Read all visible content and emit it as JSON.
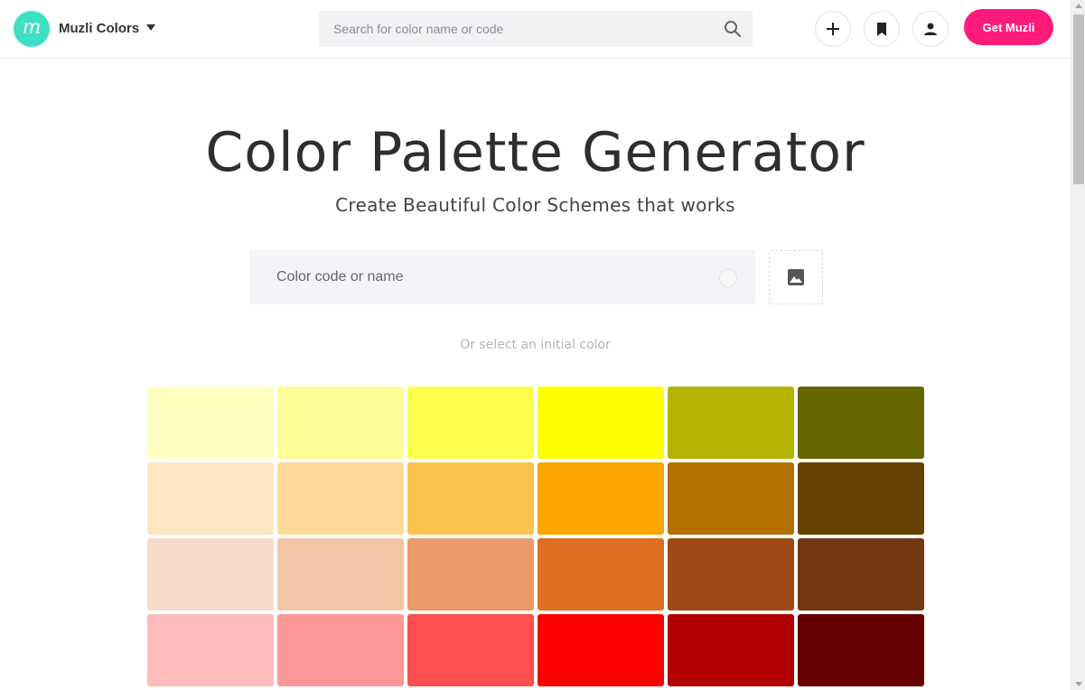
{
  "header": {
    "logo_letter": "m",
    "brand_name": "Muzli Colors",
    "search_placeholder": "Search for color name or code",
    "get_button_label": "Get Muzli",
    "accent_color": "#ff1b7a",
    "logo_color": "#3ee0c4"
  },
  "hero": {
    "title": "Color Palette Generator",
    "subtitle": "Create Beautiful Color Schemes that works",
    "input_placeholder": "Color code or name",
    "hint": "Or select an initial color"
  },
  "swatches": [
    [
      "#ffffc2",
      "#fdfd96",
      "#fdfd4b",
      "#ffff00",
      "#b3b300",
      "#666600"
    ],
    [
      "#fde6c2",
      "#fdd998",
      "#fdc14f",
      "#fca400",
      "#b37200",
      "#664200"
    ],
    [
      "#f5dbc9",
      "#f2c5a7",
      "#ea9a68",
      "#df6f21",
      "#9e4916",
      "#733711"
    ],
    [
      "#fdbbbb",
      "#fd9898",
      "#fd4f4f",
      "#ff0000",
      "#b30000",
      "#660000"
    ]
  ]
}
